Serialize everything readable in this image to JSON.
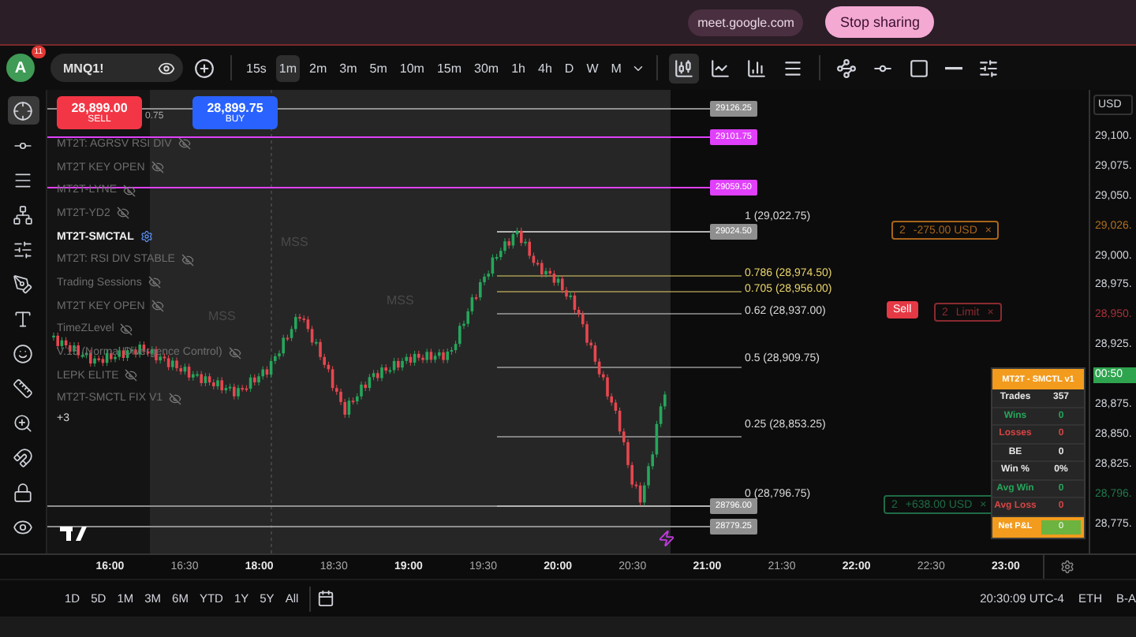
{
  "share_bar": {
    "site": "meet.google.com",
    "button": "Stop sharing"
  },
  "toolbar": {
    "avatar": "A",
    "badge": "11",
    "symbol": "MNQ1!",
    "intervals": [
      {
        "label": "15s",
        "selected": false
      },
      {
        "label": "1m",
        "selected": true
      },
      {
        "label": "2m",
        "selected": false
      },
      {
        "label": "3m",
        "selected": false
      },
      {
        "label": "5m",
        "selected": false
      },
      {
        "label": "10m",
        "selected": false
      },
      {
        "label": "15m",
        "selected": false
      },
      {
        "label": "30m",
        "selected": false
      },
      {
        "label": "1h",
        "selected": false
      },
      {
        "label": "4h",
        "selected": false
      },
      {
        "label": "D",
        "selected": false
      },
      {
        "label": "W",
        "selected": false
      },
      {
        "label": "M",
        "selected": false
      }
    ]
  },
  "tools": [
    {
      "kind": "crosshair",
      "selected": true
    },
    {
      "kind": "line",
      "selected": false
    },
    {
      "kind": "fib",
      "selected": false
    },
    {
      "kind": "pattern",
      "selected": false
    },
    {
      "kind": "projection",
      "selected": false
    },
    {
      "kind": "brush",
      "selected": false
    },
    {
      "kind": "text",
      "selected": false
    },
    {
      "kind": "emoji",
      "selected": false
    },
    {
      "kind": "ruler",
      "selected": false
    },
    {
      "kind": "zoom",
      "selected": false
    },
    {
      "kind": "magnet",
      "selected": false
    },
    {
      "kind": "lock",
      "selected": false
    },
    {
      "kind": "eye",
      "selected": false
    }
  ],
  "trade": {
    "sell_price": "28,899.00",
    "sell": "SELL",
    "spread": "0.75",
    "buy_price": "28,899.75",
    "buy": "BUY"
  },
  "indicators": [
    {
      "name": "MT2T: AGRSV RSI DIV",
      "selected": false
    },
    {
      "name": "MT2T KEY OPEN",
      "selected": false
    },
    {
      "name": "MT2T-LYNE",
      "selected": false
    },
    {
      "name": "MT2T-YD2",
      "selected": false
    },
    {
      "name": "MT2T-SMCTAL",
      "selected": true
    },
    {
      "name": "MT2T: RSI DIV STABLE",
      "selected": false
    },
    {
      "name": "Trading Sessions",
      "selected": false
    },
    {
      "name": "MT2T KEY OPEN",
      "selected": false
    },
    {
      "name": "TimeZLevel",
      "selected": false
    },
    {
      "name": "V.15 (Normal Divergence Control)",
      "selected": false
    },
    {
      "name": "LEPK ELITE",
      "selected": false
    },
    {
      "name": "MT2T-SMCTL FIX V1",
      "selected": false
    }
  ],
  "more_indicators": "+3",
  "levels": [
    {
      "price": "29126.25",
      "color": "#8f8f8f"
    },
    {
      "price": "29101.75",
      "color": "#e040fb"
    },
    {
      "price": "29059.50",
      "color": "#e040fb"
    },
    {
      "price": "29024.50",
      "color": "#8f8f8f"
    },
    {
      "price": "28796.00",
      "color": "#8f8f8f"
    },
    {
      "price": "28779.25",
      "color": "#8f8f8f"
    }
  ],
  "fib_levels": [
    {
      "text": "1 (29,022.75)",
      "color": "#d9d9d9"
    },
    {
      "text": "0.786 (28,974.50)",
      "color": "#e8d36a"
    },
    {
      "text": "0.705 (28,956.00)",
      "color": "#e8d36a"
    },
    {
      "text": "0.62 (28,937.00)",
      "color": "#d9d9d9"
    },
    {
      "text": "0.5 (28,909.75)",
      "color": "#d9d9d9"
    },
    {
      "text": "0.25 (28,853.25)",
      "color": "#d9d9d9"
    },
    {
      "text": "0 (28,796.75)",
      "color": "#d9d9d9"
    }
  ],
  "chart_labels": [
    "MSS",
    "MSS",
    "MSS"
  ],
  "orders": [
    {
      "kind": "position",
      "qty": "2",
      "text": "-275.00 USD",
      "close": "×",
      "color": "#a8641a"
    },
    {
      "kind": "limit",
      "side": "Sell",
      "qty": "2",
      "text": "Limit",
      "close": "×",
      "color": "#8a2a30"
    },
    {
      "kind": "position",
      "qty": "2",
      "text": "+638.00 USD",
      "close": "×",
      "color": "#1f6b45"
    }
  ],
  "stats": {
    "title": "MT2T - SMCTL v1",
    "rows": [
      {
        "label": "Trades",
        "value": "357",
        "color": "#e6e6e6"
      },
      {
        "label": "Wins",
        "value": "0",
        "color": "#26a65b"
      },
      {
        "label": "Losses",
        "value": "0",
        "color": "#d64545"
      },
      {
        "label": "BE",
        "value": "0",
        "color": "#e6e6e6"
      },
      {
        "label": "Win %",
        "value": "0%",
        "color": "#e6e6e6"
      },
      {
        "label": "Avg Win",
        "value": "0",
        "color": "#26a65b"
      },
      {
        "label": "Avg Loss",
        "value": "0",
        "color": "#d64545"
      }
    ],
    "footer_label": "Net P&L",
    "footer_value": "0"
  },
  "price_axis": {
    "currency": "USD",
    "labels": [
      {
        "text": "29,100.",
        "kind": "plain",
        "color": "#d1d4dc"
      },
      {
        "text": "29,075.",
        "kind": "plain",
        "color": "#d1d4dc"
      },
      {
        "text": "29,050.",
        "kind": "plain",
        "color": "#d1d4dc"
      },
      {
        "text": "29,026.",
        "kind": "plain",
        "color": "#b0701f"
      },
      {
        "text": "29,000.",
        "kind": "plain",
        "color": "#d1d4dc"
      },
      {
        "text": "28,975.",
        "kind": "plain",
        "color": "#d1d4dc"
      },
      {
        "text": "28,950.",
        "kind": "plain",
        "color": "#a8323a"
      },
      {
        "text": "28,925.",
        "kind": "plain",
        "color": "#d1d4dc"
      },
      {
        "text": "00:50",
        "kind": "tag",
        "color": "#2ea44f"
      },
      {
        "text": "28,875.",
        "kind": "plain",
        "color": "#d1d4dc"
      },
      {
        "text": "28,850.",
        "kind": "plain",
        "color": "#d1d4dc"
      },
      {
        "text": "28,825.",
        "kind": "plain",
        "color": "#d1d4dc"
      },
      {
        "text": "28,796.",
        "kind": "plain",
        "color": "#1f7a4d"
      },
      {
        "text": "28,775.",
        "kind": "plain",
        "color": "#d1d4dc"
      }
    ]
  },
  "time_axis": [
    {
      "label": "16:00",
      "major": true
    },
    {
      "label": "16:30",
      "major": false
    },
    {
      "label": "18:00",
      "major": true
    },
    {
      "label": "18:30",
      "major": false
    },
    {
      "label": "19:00",
      "major": true
    },
    {
      "label": "19:30",
      "major": false
    },
    {
      "label": "20:00",
      "major": true
    },
    {
      "label": "20:30",
      "major": false
    },
    {
      "label": "21:00",
      "major": true
    },
    {
      "label": "21:30",
      "major": false
    },
    {
      "label": "22:00",
      "major": true
    },
    {
      "label": "22:30",
      "major": false
    },
    {
      "label": "23:00",
      "major": true
    }
  ],
  "ranges": [
    "1D",
    "5D",
    "1M",
    "3M",
    "6M",
    "YTD",
    "1Y",
    "5Y",
    "All"
  ],
  "status": {
    "clock": "20:30:09 UTC-4",
    "session": "ETH",
    "adjust": "B-A"
  }
}
